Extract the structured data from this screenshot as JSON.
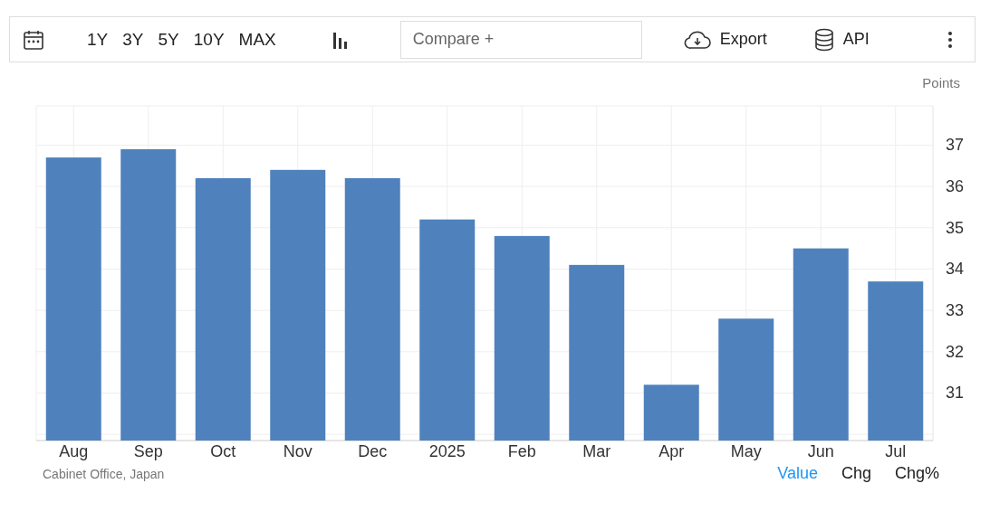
{
  "toolbar": {
    "ranges": [
      "1Y",
      "3Y",
      "5Y",
      "10Y",
      "MAX"
    ],
    "compare": {
      "placeholder": "Compare +"
    },
    "export": "Export",
    "api": "API"
  },
  "chart": {
    "chart_data": {
      "type": "bar",
      "ylabel": "Points",
      "categories": [
        "Aug",
        "Sep",
        "Oct",
        "Nov",
        "Dec",
        "2025",
        "Feb",
        "Mar",
        "Apr",
        "May",
        "Jun",
        "Jul"
      ],
      "grid": true,
      "series": [
        {
          "color": "#4f81bd",
          "values": [
            36.7,
            36.9,
            36.2,
            36.4,
            36.2,
            35.2,
            34.8,
            34.1,
            31.2,
            32.8,
            34.5,
            33.7
          ]
        }
      ],
      "ylim": [
        29.85,
        37.95
      ],
      "yticks": [
        31,
        32,
        33,
        34,
        35,
        36,
        37
      ]
    }
  },
  "footer": {
    "source": "Cabinet Office, Japan",
    "tabs": [
      {
        "label": "Value",
        "selected": true
      },
      {
        "label": "Chg",
        "selected": false
      },
      {
        "label": "Chg%",
        "selected": false
      }
    ]
  }
}
